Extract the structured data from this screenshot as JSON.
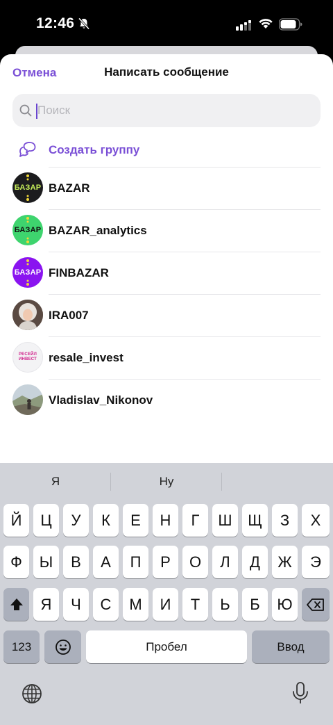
{
  "status_bar": {
    "time": "12:46",
    "icons": [
      "bell-slash-icon",
      "cellular-signal-icon",
      "wifi-icon",
      "battery-icon"
    ]
  },
  "header": {
    "cancel_label": "Отмена",
    "title": "Написать сообщение"
  },
  "search": {
    "placeholder": "Поиск",
    "value": ""
  },
  "create_group": {
    "label": "Создать группу",
    "icon": "chat-bubbles-icon"
  },
  "contacts": [
    {
      "name": "BAZAR",
      "avatar_text": "БАЗАР",
      "avatar_bg": "#1c1c1e",
      "avatar_fg": "#c8f05a"
    },
    {
      "name": "BAZAR_analytics",
      "avatar_text": "БАЗАР",
      "avatar_bg": "#3ed46e",
      "avatar_fg": "#111111"
    },
    {
      "name": "FINBAZAR",
      "avatar_text": "БАЗАР",
      "avatar_bg": "#8a14f0",
      "avatar_fg": "#ffffff"
    },
    {
      "name": "IRA007",
      "avatar_text": "",
      "avatar_bg": "#c9b8ad",
      "avatar_fg": "#ffffff"
    },
    {
      "name": "resale_invest",
      "avatar_text": "РЕСЕЙЛ ИНВЕСТ",
      "avatar_bg": "#f3f3f5",
      "avatar_fg": "#d0208a"
    },
    {
      "name": "Vladislav_Nikonov",
      "avatar_text": "",
      "avatar_bg": "#8e9a86",
      "avatar_fg": "#ffffff"
    }
  ],
  "keyboard": {
    "suggestions": [
      "Я",
      "Ну",
      ""
    ],
    "row1": [
      "Й",
      "Ц",
      "У",
      "К",
      "Е",
      "Н",
      "Г",
      "Ш",
      "Щ",
      "З",
      "Х"
    ],
    "row2": [
      "Ф",
      "Ы",
      "В",
      "А",
      "П",
      "Р",
      "О",
      "Л",
      "Д",
      "Ж",
      "Э"
    ],
    "row3": [
      "Я",
      "Ч",
      "С",
      "М",
      "И",
      "Т",
      "Ь",
      "Б",
      "Ю"
    ],
    "numbers_label": "123",
    "space_label": "Пробел",
    "return_label": "Ввод"
  },
  "colors": {
    "accent": "#7a4fd6",
    "keyboard_bg": "#d1d3d9"
  }
}
